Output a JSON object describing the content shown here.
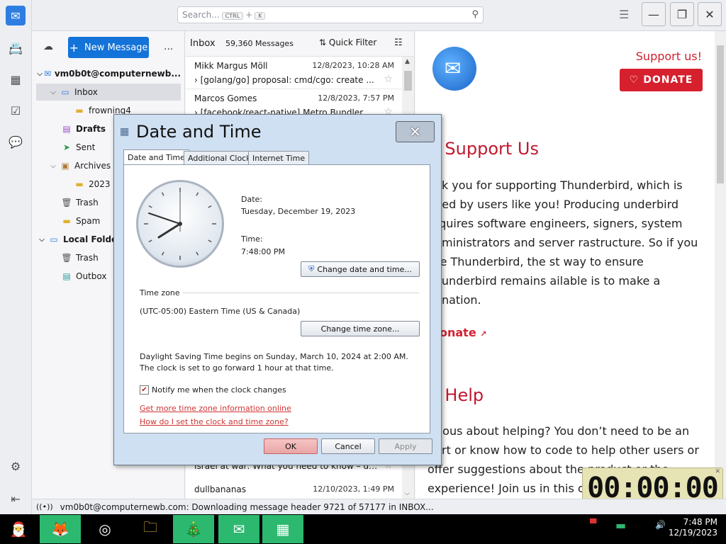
{
  "search": {
    "placeholder": "Search...",
    "kbd1": "CTRL",
    "plus": "+",
    "kbd2": "K"
  },
  "folder_pane": {
    "new_message": "New Message",
    "more": "...",
    "account": "vm0b0t@computernewb...",
    "folders": [
      {
        "label": "Inbox"
      },
      {
        "label": "frowning4"
      },
      {
        "label": "Drafts"
      },
      {
        "label": "Sent"
      },
      {
        "label": "Archives"
      },
      {
        "label": "2023"
      },
      {
        "label": "Trash"
      },
      {
        "label": "Spam"
      },
      {
        "label": "Local Folders"
      },
      {
        "label": "Trash"
      },
      {
        "label": "Outbox"
      }
    ]
  },
  "thread_pane": {
    "folder": "Inbox",
    "count": "59,360 Messages",
    "quick_filter": "Quick Filter",
    "messages": [
      {
        "from": "Mikk Margus Möll",
        "date": "12/8/2023, 10:28 AM",
        "subject": "[golang/go] proposal: cmd/cgo: create ..."
      },
      {
        "from": "Marcos Gomes",
        "date": "12/8/2023, 7:57 PM",
        "subject": "[facebook/react-native] Metro Bundler n..."
      },
      {
        "from": "",
        "date": "",
        "subject": "Israel at war: What you need to know – da..."
      },
      {
        "from": "dullbananas",
        "date": "12/10/2023, 1:49 PM",
        "subject": ""
      }
    ]
  },
  "message_pane": {
    "support_link": "Support us!",
    "donate_button": "DONATE",
    "support_heading": "Support Us",
    "support_text": "ank you for supporting Thunderbird, which is nded by users like you! Producing underbird requires software engineers, signers, system administrators and server rastructure. So if you like Thunderbird, the st way to ensure Thunderbird remains ailable is to make a donation.",
    "donate_link": "onate",
    "help_heading": "Help",
    "help_text": "urious about helping? You don’t need to be an pert or know how to code to help other users or offer suggestions about the product or the experience! Join us in this c"
  },
  "status_bar": {
    "text": "vm0b0t@computernewb.com: Downloading message header 9721 of 57177 in INBOX..."
  },
  "timer": {
    "value": "00:00:00"
  },
  "taskbar": {
    "time": "7:48 PM",
    "date": "12/19/2023"
  },
  "dialog": {
    "title": "Date and Time",
    "close": "✕",
    "tabs": [
      "Date and Time",
      "Additional Clocks",
      "Internet Time"
    ],
    "date_label": "Date:",
    "date_value": "Tuesday, December 19, 2023",
    "time_label": "Time:",
    "time_value": "7:48:00 PM",
    "change_datetime": "Change date and time...",
    "timezone_label": "Time zone",
    "timezone_value": "(UTC-05:00) Eastern Time (US & Canada)",
    "change_timezone": "Change time zone...",
    "dst_text": "Daylight Saving Time begins on Sunday, March 10, 2024 at 2:00 AM. The clock is set to go forward 1 hour at that time.",
    "notify_label": "Notify me when the clock changes",
    "notify_checked": true,
    "link1": "Get more time zone information online",
    "link2": "How do I set the clock and time zone?",
    "ok": "OK",
    "cancel": "Cancel",
    "apply": "Apply"
  }
}
